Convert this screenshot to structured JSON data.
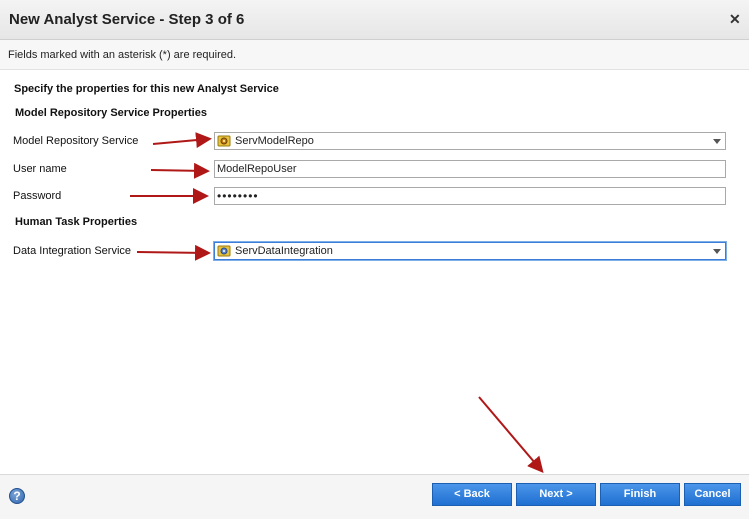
{
  "window": {
    "title": "New Analyst Service - Step 3 of 6",
    "close_glyph": "✕"
  },
  "required_note": "Fields marked with an asterisk (*) are required.",
  "heading": "Specify the properties for this new Analyst Service",
  "model_repo_section": {
    "title": "Model Repository Service Properties",
    "service_label": "Model Repository Service",
    "service_value": "ServModelRepo",
    "service_icon": "service-icon",
    "username_label": "User name",
    "username_value": "ModelRepoUser",
    "password_label": "Password",
    "password_value": "••••••••"
  },
  "human_task_section": {
    "title": "Human Task Properties",
    "dis_label": "Data Integration Service",
    "dis_value": "ServDataIntegration",
    "dis_icon": "service-icon"
  },
  "footer": {
    "help_glyph": "?",
    "back_label": "< Back",
    "next_label": "Next >",
    "finish_label": "Finish",
    "cancel_label": "Cancel"
  },
  "colors": {
    "button": "#2a7bdc",
    "annotation_arrow": "#b01818"
  }
}
